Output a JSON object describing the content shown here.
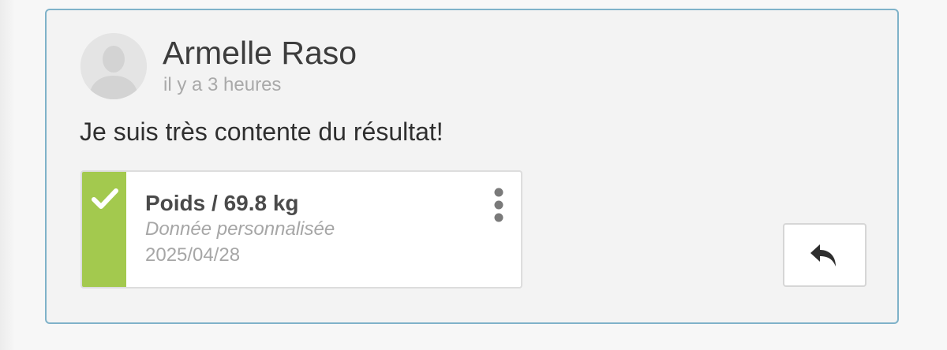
{
  "post": {
    "author_name": "Armelle Raso",
    "timestamp": "il y a 3 heures",
    "message": "Je suis très contente du résultat!",
    "avatar_icon": "default-user-avatar-icon"
  },
  "data_entry": {
    "title": "Poids / 69.8 kg",
    "source": "Donnée personnalisée",
    "date": "2025/04/28",
    "status_icon": "check-icon",
    "status_color": "#a3c94e",
    "menu_icon": "vertical-dots-icon"
  },
  "actions": {
    "reply_icon": "reply-arrow-icon"
  },
  "colors": {
    "card_border": "#7fb2c9",
    "card_background": "#f3f3f3"
  }
}
